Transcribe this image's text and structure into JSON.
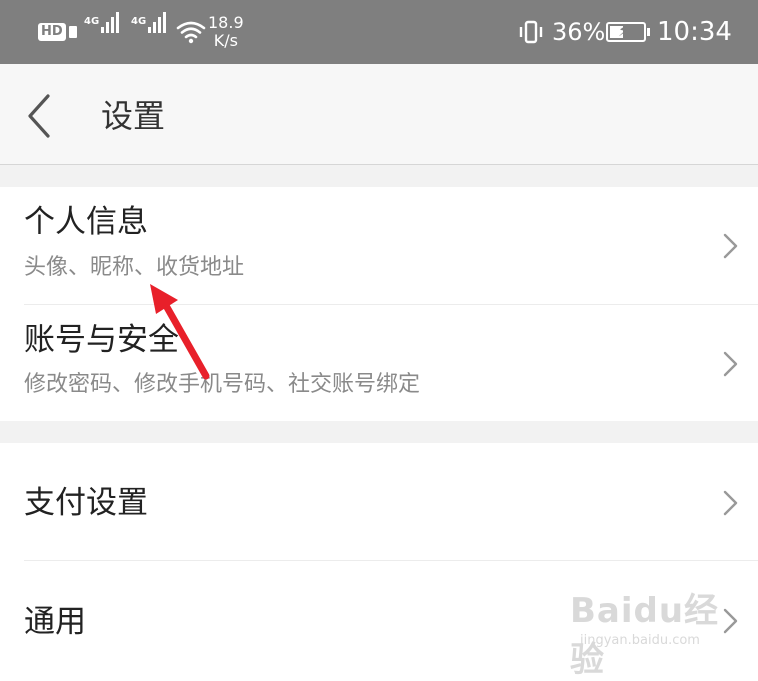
{
  "status_bar": {
    "hd_label": "HD",
    "network_1": "4G",
    "network_2": "4G",
    "speed_value": "18.9",
    "speed_unit": "K/s",
    "battery": "36%",
    "time": "10:34"
  },
  "header": {
    "title": "设置"
  },
  "settings": {
    "personal_info": {
      "title": "个人信息",
      "subtitle": "头像、昵称、收货地址"
    },
    "account_security": {
      "title": "账号与安全",
      "subtitle": "修改密码、修改手机号码、社交账号绑定"
    },
    "payment_settings": {
      "title": "支付设置"
    },
    "general": {
      "title": "通用"
    }
  },
  "watermark": {
    "logo_text": "Baidu经验",
    "url": "jingyan.baidu.com"
  },
  "colors": {
    "status_bar": "#7f7f7f",
    "app_bar": "#f7f7f7",
    "section_gap": "#f2f2f2",
    "annotation_arrow": "#e8202a"
  },
  "icons": {
    "back": "chevron-left-icon",
    "row_chevron": "chevron-right-icon"
  }
}
